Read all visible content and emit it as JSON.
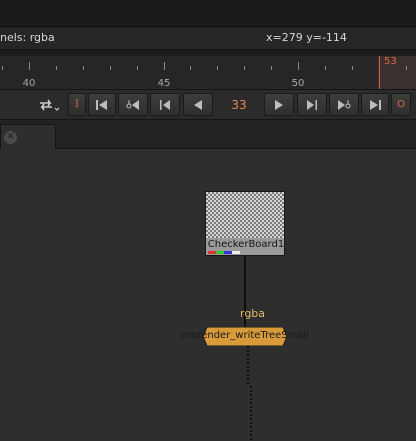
{
  "info": {
    "channels": "nels: rgba",
    "coords": "x=279 y=-114"
  },
  "timeline": {
    "major_labels": [
      "40",
      "45",
      "50"
    ],
    "playhead_frame": "53"
  },
  "transport": {
    "in_marker": "I",
    "current_frame": "33",
    "out_marker": "O"
  },
  "nodes": {
    "checkerboard": {
      "label": "CheckerBoard1"
    },
    "write": {
      "label": "prerender_writeTreeSmall"
    }
  },
  "edge": {
    "label": "rgba"
  },
  "colors": {
    "accent_orange": "#e08a50",
    "playhead_red": "#d35a3a",
    "write_node": "#d99a3a",
    "edge_label": "#e4b86a"
  }
}
